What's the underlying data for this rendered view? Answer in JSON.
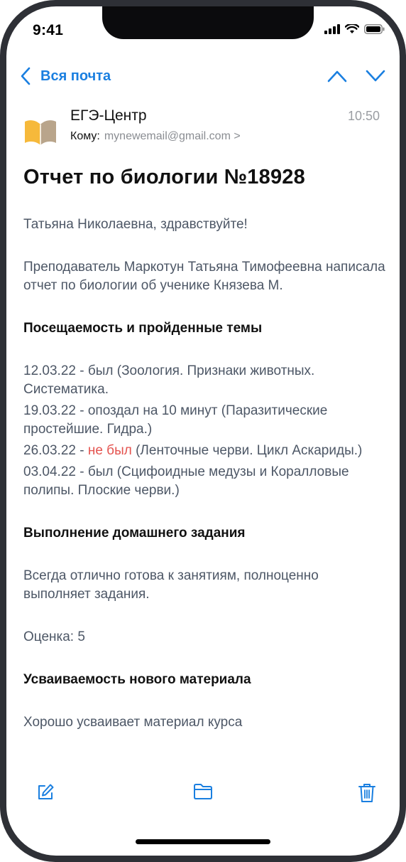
{
  "status": {
    "time": "9:41"
  },
  "nav": {
    "back_label": "Вся почта"
  },
  "email": {
    "sender": "ЕГЭ-Центр",
    "to_label": "Кому:",
    "to_address": "mynewemail@gmail.com >",
    "time": "10:50",
    "subject": "Отчет по биологии №18928",
    "greeting": "Татьяна Николаевна, здравствуйте!",
    "intro": "Преподаватель Маркотун Татьяна Тимофеевна написала отчет по биологии об ученике Князева М.",
    "attendance_heading": "Посещаемость и пройденные темы",
    "attendance": [
      {
        "pre": "12.03.22 - был (Зоология. Признаки животных. Систематика.",
        "status": "",
        "post": ""
      },
      {
        "pre": "19.03.22 - опоздал на 10 минут (Паразитические простейшие. Гидра.)",
        "status": "",
        "post": ""
      },
      {
        "pre": "26.03.22 - ",
        "status": "не был",
        "post": " (Ленточные черви. Цикл Аскариды.)"
      },
      {
        "pre": "03.04.22 - был (Сцифоидные медузы и Коралловые полипы. Плоские черви.)",
        "status": "",
        "post": ""
      }
    ],
    "homework_heading": "Выполнение домашнего задания",
    "homework_text": "Всегда отлично готова к занятиям, полноценно выполняет задания.",
    "grade": "Оценка: 5",
    "mastery_heading": "Усваиваемость нового материала",
    "mastery_text": "Хорошо усваивает материал курса"
  },
  "toolbar": {
    "icons": [
      "compose-icon",
      "folder-icon",
      "trash-icon"
    ]
  },
  "colors": {
    "accent": "#1a7fe0",
    "absent": "#e4534f",
    "body_text": "#4d5766"
  }
}
